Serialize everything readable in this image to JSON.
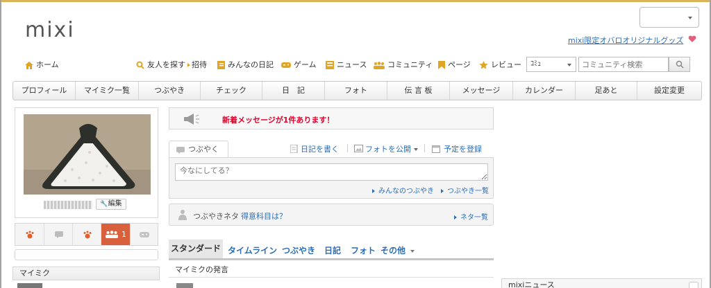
{
  "header": {
    "logo": "mixi",
    "promo_link": "mixi限定オバロオリジナルグッズ"
  },
  "nav": {
    "items": [
      {
        "label": "ホーム",
        "icon": "home-icon"
      },
      {
        "label": "友人を探す",
        "icon": "search-icon"
      },
      {
        "label": "招待",
        "icon": "arrow-right-icon"
      },
      {
        "label": "みんなの日記",
        "icon": "diary-icon"
      },
      {
        "label": "ゲーム",
        "icon": "gamepad-icon"
      },
      {
        "label": "ニュース",
        "icon": "news-icon"
      },
      {
        "label": "コミュニティ",
        "icon": "community-icon"
      },
      {
        "label": "ページ",
        "icon": "bookmark-icon"
      },
      {
        "label": "レビュー",
        "icon": "star-icon"
      }
    ],
    "search_scope": "ｺﾐｭ",
    "search_placeholder": "コミュニティ検索"
  },
  "tabs": [
    "プロフィール",
    "マイミク一覧",
    "つぶやき",
    "チェック",
    "日　記",
    "フォト",
    "伝 言 板",
    "メッセージ",
    "カレンダー",
    "足あと",
    "設定変更"
  ],
  "profile": {
    "edit_label": "編集",
    "friend_request_count": "1"
  },
  "notice": {
    "text": "新着メッセージが1件あります！"
  },
  "tsubuyaki": {
    "tab_label": "つぶやく",
    "write_diary": "日記を書く",
    "publish_photo": "フォトを公開",
    "register_schedule": "予定を登録",
    "placeholder": "今なにしてる？",
    "everyone_link": "みんなのつぶやき",
    "list_link": "つぶやき一覧"
  },
  "neta": {
    "label": "つぶやきネタ",
    "question": "得意科目は？",
    "list_link": "ネタ一覧"
  },
  "feed": {
    "tabs": [
      "スタンダード",
      "タイムライン",
      "つぶやき",
      "日記",
      "フォト",
      "その他"
    ],
    "subheading": "マイミクの発言"
  },
  "sidebar": {
    "section_title": "マイミク"
  },
  "news": {
    "title": "mixiニュース"
  },
  "colors": {
    "accent_gold": "#d9b45a",
    "link_blue": "#2a6db5",
    "alert_red": "#e4002b",
    "active_orange": "#d9603c"
  }
}
